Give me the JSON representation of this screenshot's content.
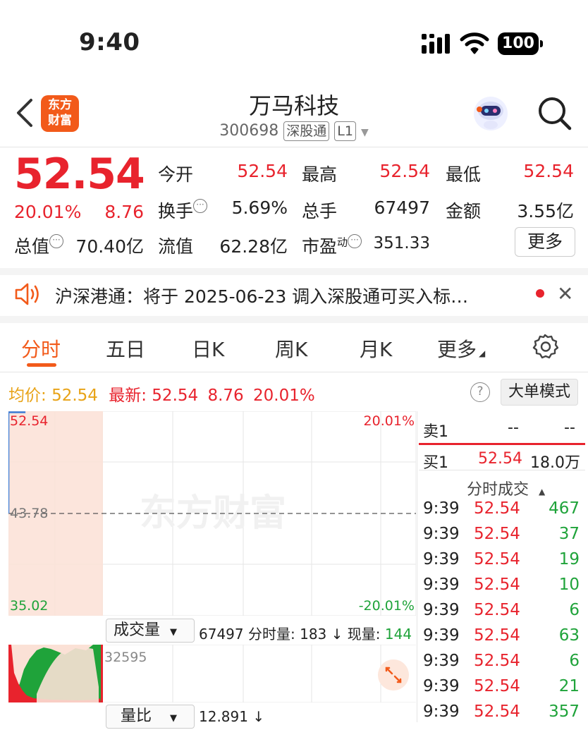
{
  "status_bar": {
    "time": "9:40",
    "battery": "100"
  },
  "header": {
    "logo_line1": "东方",
    "logo_line2": "财富",
    "stock_name": "万马科技",
    "stock_code": "300698",
    "tag1": "深股通",
    "tag2": "L1"
  },
  "quote": {
    "price": "52.54",
    "change_pct": "20.01%",
    "change": "8.76",
    "open_label": "今开",
    "open": "52.54",
    "high_label": "最高",
    "high": "52.54",
    "low_label": "最低",
    "low": "52.54",
    "turnover_label": "换手",
    "turnover": "5.69%",
    "volume_label": "总手",
    "volume": "67497",
    "amount_label": "金额",
    "amount": "3.55亿",
    "mcap_label": "总值",
    "mcap": "70.40亿",
    "float_label": "流值",
    "float": "62.28亿",
    "pe_label": "市盈",
    "pe_sup": "动",
    "pe": "351.33",
    "more_label": "更多"
  },
  "notice": {
    "text": "沪深港通：将于 2025-06-23 调入深股通可买入标…"
  },
  "tabs": [
    {
      "label": "分时"
    },
    {
      "label": "五日"
    },
    {
      "label": "日K"
    },
    {
      "label": "周K"
    },
    {
      "label": "月K"
    },
    {
      "label": "更多"
    }
  ],
  "legend": {
    "avg_label": "均价:",
    "avg": "52.54",
    "latest_label": "最新:",
    "latest": "52.54",
    "latest_change": "8.76",
    "latest_pct": "20.01%",
    "mode_label": "大单模式"
  },
  "chart_data": {
    "type": "line",
    "y_high": "52.54",
    "y_mid": "43.78",
    "y_low": "35.02",
    "pct_high": "20.01%",
    "pct_low": "-20.01%",
    "watermark": "东方财富",
    "session_minutes": 240,
    "elapsed_minutes": 10,
    "price_points": [
      [
        0,
        43.78
      ],
      [
        0,
        52.54
      ],
      [
        10,
        52.54
      ]
    ],
    "ylim": [
      35.02,
      52.54
    ],
    "colors": {
      "up": "#e8232d",
      "down": "#1fa33a",
      "price_line": "#3a7bd5"
    }
  },
  "volume": {
    "selector_label": "成交量",
    "total": "67497",
    "min_label": "分时量:",
    "min_value": "183",
    "now_label": "现量:",
    "now_value": "144",
    "max_label": "32595",
    "ratio_label": "量比",
    "ratio_value": "12.891"
  },
  "orderbook": {
    "sell1_label": "卖1",
    "sell1_price": "--",
    "sell1_vol": "--",
    "buy1_label": "买1",
    "buy1_price": "52.54",
    "buy1_vol": "18.0万"
  },
  "ticks": {
    "title": "分时成交",
    "rows": [
      {
        "time": "9:39",
        "price": "52.54",
        "vol": "467"
      },
      {
        "time": "9:39",
        "price": "52.54",
        "vol": "37"
      },
      {
        "time": "9:39",
        "price": "52.54",
        "vol": "19"
      },
      {
        "time": "9:39",
        "price": "52.54",
        "vol": "10"
      },
      {
        "time": "9:39",
        "price": "52.54",
        "vol": "6"
      },
      {
        "time": "9:39",
        "price": "52.54",
        "vol": "63"
      },
      {
        "time": "9:39",
        "price": "52.54",
        "vol": "6"
      },
      {
        "time": "9:39",
        "price": "52.54",
        "vol": "21"
      },
      {
        "time": "9:39",
        "price": "52.54",
        "vol": "357"
      }
    ]
  }
}
